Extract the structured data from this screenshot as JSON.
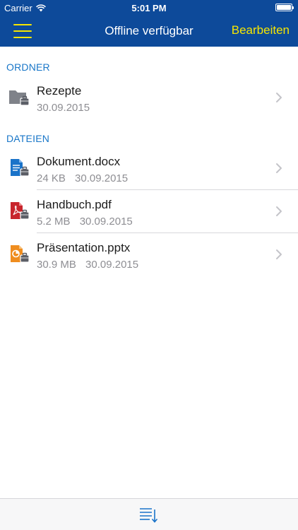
{
  "status_bar": {
    "carrier": "Carrier",
    "time": "5:01 PM"
  },
  "nav": {
    "title": "Offline verfügbar",
    "edit_label": "Bearbeiten"
  },
  "colors": {
    "header_bg": "#0d4a9a",
    "accent_yellow": "#f7e600",
    "section_blue": "#1876c8"
  },
  "sections": {
    "folders": {
      "label": "ORDNER",
      "items": [
        {
          "name": "Rezepte",
          "date": "30.09.2015",
          "icon": "folder-icon"
        }
      ]
    },
    "files": {
      "label": "DATEIEN",
      "items": [
        {
          "name": "Dokument.docx",
          "size": "24 KB",
          "date": "30.09.2015",
          "icon": "word-document-icon"
        },
        {
          "name": "Handbuch.pdf",
          "size": "5.2 MB",
          "date": "30.09.2015",
          "icon": "pdf-document-icon"
        },
        {
          "name": "Präsentation.pptx",
          "size": "30.9 MB",
          "date": "30.09.2015",
          "icon": "powerpoint-document-icon"
        }
      ]
    }
  }
}
